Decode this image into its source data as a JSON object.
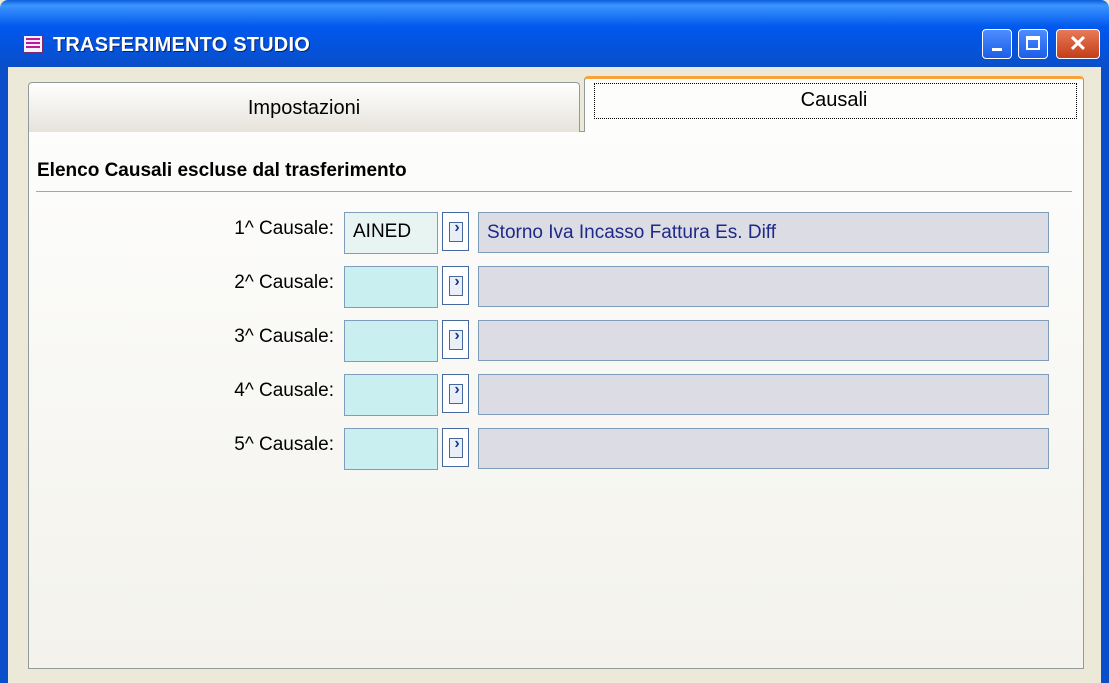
{
  "window": {
    "title": "TRASFERIMENTO STUDIO",
    "controls": [
      "minimize",
      "maximize",
      "close"
    ],
    "close_glyph": "✕"
  },
  "tabs": [
    {
      "label": "Impostazioni",
      "active": false
    },
    {
      "label": "Causali",
      "active": true
    }
  ],
  "section": {
    "heading": "Elenco Causali escluse dal trasferimento"
  },
  "rows": [
    {
      "label": "1^ Causale:",
      "code": "AINED",
      "description": "Storno Iva Incasso Fattura Es. Diff"
    },
    {
      "label": "2^ Causale:",
      "code": "",
      "description": ""
    },
    {
      "label": "3^ Causale:",
      "code": "",
      "description": ""
    },
    {
      "label": "4^ Causale:",
      "code": "",
      "description": ""
    },
    {
      "label": "5^ Causale:",
      "code": "",
      "description": ""
    }
  ],
  "lookup_glyph": "›",
  "colors": {
    "titlebar": "#0058ee",
    "code_field_bg": "#c9eff0",
    "desc_field_bg": "#dcdce4",
    "desc_text": "#1e2a86",
    "active_tab_accent": "#f9a33a"
  }
}
